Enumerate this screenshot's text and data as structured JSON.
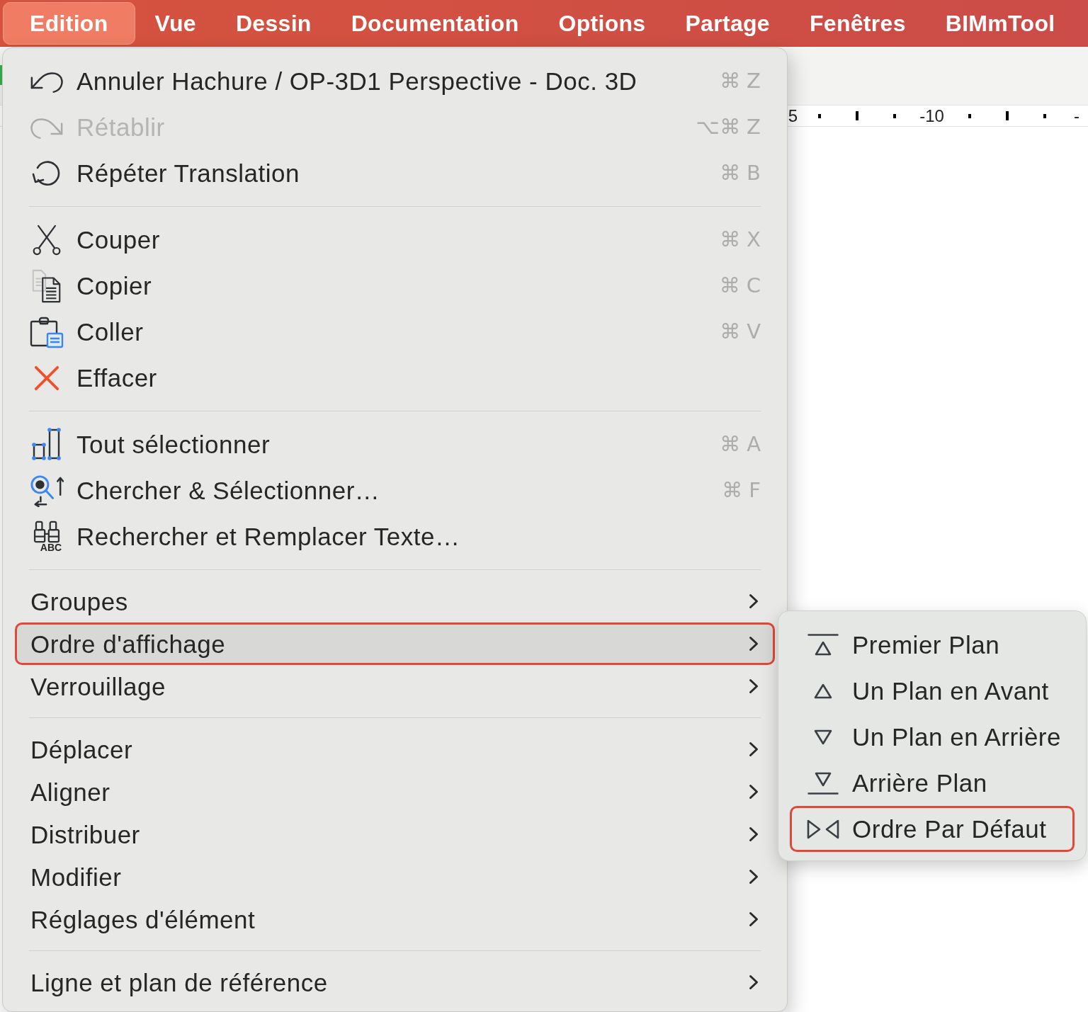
{
  "menubar": {
    "items": [
      {
        "label": "Edition",
        "selected": true
      },
      {
        "label": "Vue",
        "selected": false
      },
      {
        "label": "Dessin",
        "selected": false
      },
      {
        "label": "Documentation",
        "selected": false
      },
      {
        "label": "Options",
        "selected": false
      },
      {
        "label": "Partage",
        "selected": false
      },
      {
        "label": "Fenêtres",
        "selected": false
      },
      {
        "label": "BIMmTool",
        "selected": false
      }
    ]
  },
  "ruler": {
    "labels": [
      "5",
      "-10",
      "-"
    ]
  },
  "menu": {
    "sections": [
      {
        "items": [
          {
            "kind": "command",
            "label": "Annuler Hachure / OP-3D1 Perspective - Doc. 3D",
            "shortcut": "⌘ Z",
            "disabled": false,
            "selected": false
          },
          {
            "kind": "command",
            "label": "Rétablir",
            "shortcut": "⌥⌘ Z",
            "disabled": true,
            "selected": false
          },
          {
            "kind": "command",
            "label": "Répéter Translation",
            "shortcut": "⌘ B",
            "disabled": false,
            "selected": false
          }
        ]
      },
      {
        "items": [
          {
            "kind": "command",
            "label": "Couper",
            "shortcut": "⌘ X",
            "disabled": false,
            "selected": false
          },
          {
            "kind": "command",
            "label": "Copier",
            "shortcut": "⌘ C",
            "disabled": false,
            "selected": false
          },
          {
            "kind": "command",
            "label": "Coller",
            "shortcut": "⌘ V",
            "disabled": false,
            "selected": false
          },
          {
            "kind": "command",
            "label": "Effacer",
            "disabled": false,
            "selected": false
          }
        ]
      },
      {
        "items": [
          {
            "kind": "command",
            "label": "Tout sélectionner",
            "shortcut": "⌘ A",
            "disabled": false,
            "selected": false
          },
          {
            "kind": "command",
            "label": "Chercher & Sélectionner…",
            "shortcut": "⌘ F",
            "disabled": false,
            "selected": false
          },
          {
            "kind": "command",
            "label": "Rechercher et Remplacer Texte…",
            "icon_caption": "ABC",
            "disabled": false,
            "selected": false
          }
        ]
      },
      {
        "items": [
          {
            "kind": "submenu",
            "label": "Groupes",
            "disabled": false,
            "selected": false
          },
          {
            "kind": "submenu",
            "label": "Ordre d'affichage",
            "disabled": false,
            "selected": true
          },
          {
            "kind": "submenu",
            "label": "Verrouillage",
            "disabled": false,
            "selected": false
          }
        ]
      },
      {
        "items": [
          {
            "kind": "submenu",
            "label": "Déplacer",
            "disabled": false,
            "selected": false
          },
          {
            "kind": "submenu",
            "label": "Aligner",
            "disabled": false,
            "selected": false
          },
          {
            "kind": "submenu",
            "label": "Distribuer",
            "disabled": false,
            "selected": false
          },
          {
            "kind": "submenu",
            "label": "Modifier",
            "disabled": false,
            "selected": false
          },
          {
            "kind": "submenu",
            "label": "Réglages d'élément",
            "disabled": false,
            "selected": false
          }
        ]
      },
      {
        "items": [
          {
            "kind": "submenu",
            "label": "Ligne et plan de référence",
            "disabled": false,
            "selected": false
          }
        ]
      }
    ]
  },
  "submenu": {
    "items": [
      {
        "label": "Premier Plan",
        "selected": false
      },
      {
        "label": "Un Plan en Avant",
        "selected": false
      },
      {
        "label": "Un Plan en Arrière",
        "selected": false
      },
      {
        "label": "Arrière Plan",
        "selected": false
      },
      {
        "label": "Ordre Par Défaut",
        "selected": true
      }
    ]
  }
}
